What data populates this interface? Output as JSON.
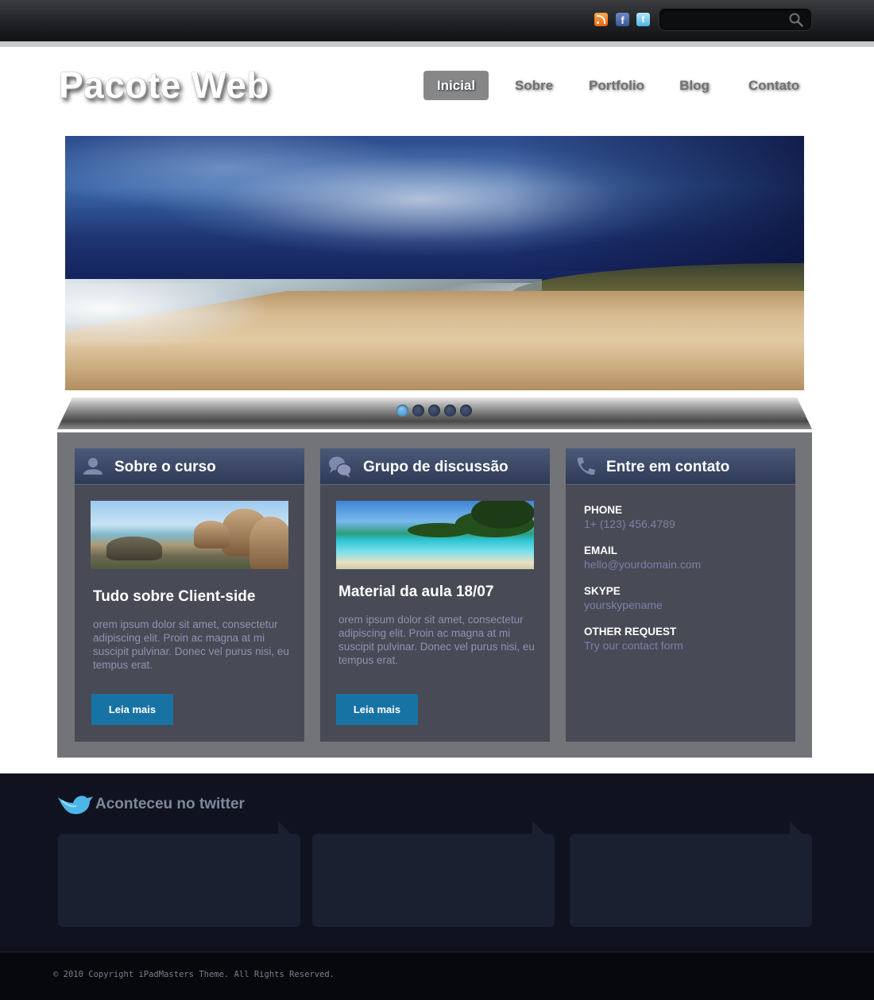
{
  "topbar": {
    "icons": [
      "rss-icon",
      "facebook-icon",
      "twitter-icon"
    ],
    "facebook_glyph": "f",
    "twitter_glyph": "t",
    "search": {
      "value": "",
      "placeholder": ""
    }
  },
  "header": {
    "logo": "Pacote Web",
    "nav": [
      {
        "label": "Inicial",
        "active": true
      },
      {
        "label": "Sobre",
        "active": false
      },
      {
        "label": "Portfolio",
        "active": false
      },
      {
        "label": "Blog",
        "active": false
      },
      {
        "label": "Contato",
        "active": false
      }
    ]
  },
  "slider": {
    "slide_count": 5,
    "active_index": 0
  },
  "boxes": [
    {
      "title": "Sobre o curso",
      "icon": "user-icon",
      "post_title": "Tudo sobre Client-side",
      "text": "orem ipsum dolor sit amet, consectetur adipiscing elit. Proin ac magna at mi suscipit pulvinar. Donec vel purus nisi, eu tempus erat.",
      "button": "Leia mais"
    },
    {
      "title": "Grupo de discussão",
      "icon": "chat-bubbles-icon",
      "post_title": "Material da aula 18/07",
      "text": "orem ipsum dolor sit amet, consectetur adipiscing elit. Proin ac magna at mi suscipit pulvinar. Donec vel purus nisi, eu tempus erat.",
      "button": "Leia mais"
    },
    {
      "title": "Entre em contato",
      "icon": "phone-icon",
      "contacts": [
        {
          "label": "PHONE",
          "value": "1+ (123) 456.4789"
        },
        {
          "label": "EMAIL",
          "value": "hello@yourdomain.com"
        },
        {
          "label": "SKYPE",
          "value": "yourskypename"
        },
        {
          "label": "OTHER REQUEST",
          "value": "Try our contact form"
        }
      ]
    }
  ],
  "twitter": {
    "title": "Aconteceu no twitter",
    "tweets": [
      "",
      "",
      ""
    ]
  },
  "footer": {
    "copyright": "© 2010 Copyright iPadMasters Theme. All Rights Reserved."
  },
  "colors": {
    "accent_button": "#1873a5",
    "box_bg": "#484a55",
    "twitter_bg": "#10131f"
  }
}
